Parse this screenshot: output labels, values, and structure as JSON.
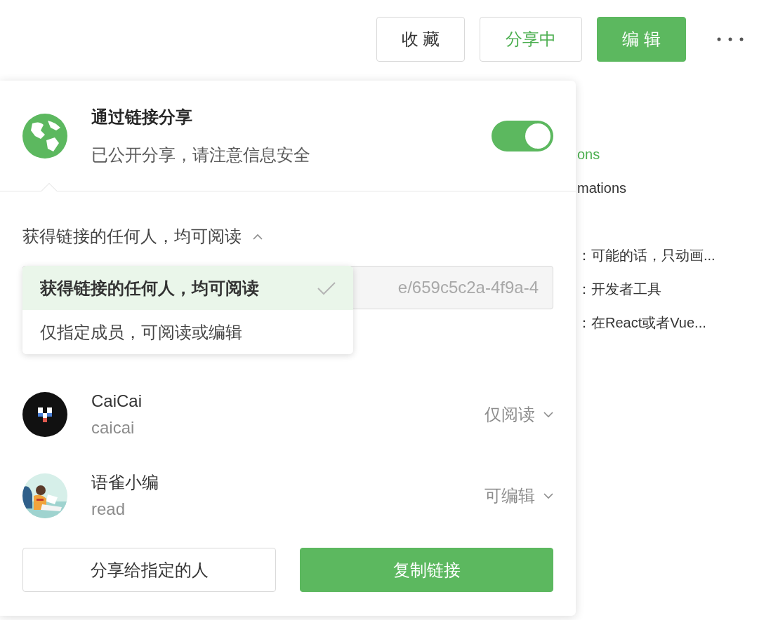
{
  "toolbar": {
    "buttons": [
      {
        "label": "收 藏",
        "kind": "default"
      },
      {
        "label": "分享中",
        "kind": "active"
      },
      {
        "label": "编 辑",
        "kind": "primary"
      }
    ]
  },
  "background_text": [
    {
      "text": "ons",
      "kind": "link"
    },
    {
      "text": "mations",
      "kind": "plain"
    },
    {
      "text": "：可能的话，只动画...",
      "kind": "plain"
    },
    {
      "text": "：开发者工具",
      "kind": "plain"
    },
    {
      "text": "：在React或者Vue...",
      "kind": "plain"
    }
  ],
  "share_popup": {
    "title": "通过链接分享",
    "subtitle": "已公开分享，请注意信息安全",
    "toggle": {
      "on": true
    },
    "access": {
      "label": "获得链接的任何人，均可阅读",
      "expanded": true,
      "options": [
        {
          "label": "获得链接的任何人，均可阅读",
          "selected": true
        },
        {
          "label": "仅指定成员，可阅读或编辑",
          "selected": false
        }
      ]
    },
    "link_field": {
      "value": "e/659c5c2a-4f9a-4"
    },
    "members": [
      {
        "name": "CaiCai",
        "username": "caicai",
        "permission": "仅阅读",
        "avatar": {
          "kind": "logo"
        }
      },
      {
        "name": "语雀小编",
        "username": "read",
        "permission": "可编辑"
      }
    ],
    "buttons": [
      {
        "label": "分享给指定的人",
        "kind": "default"
      },
      {
        "label": "复制链接",
        "kind": "primary"
      }
    ]
  }
}
